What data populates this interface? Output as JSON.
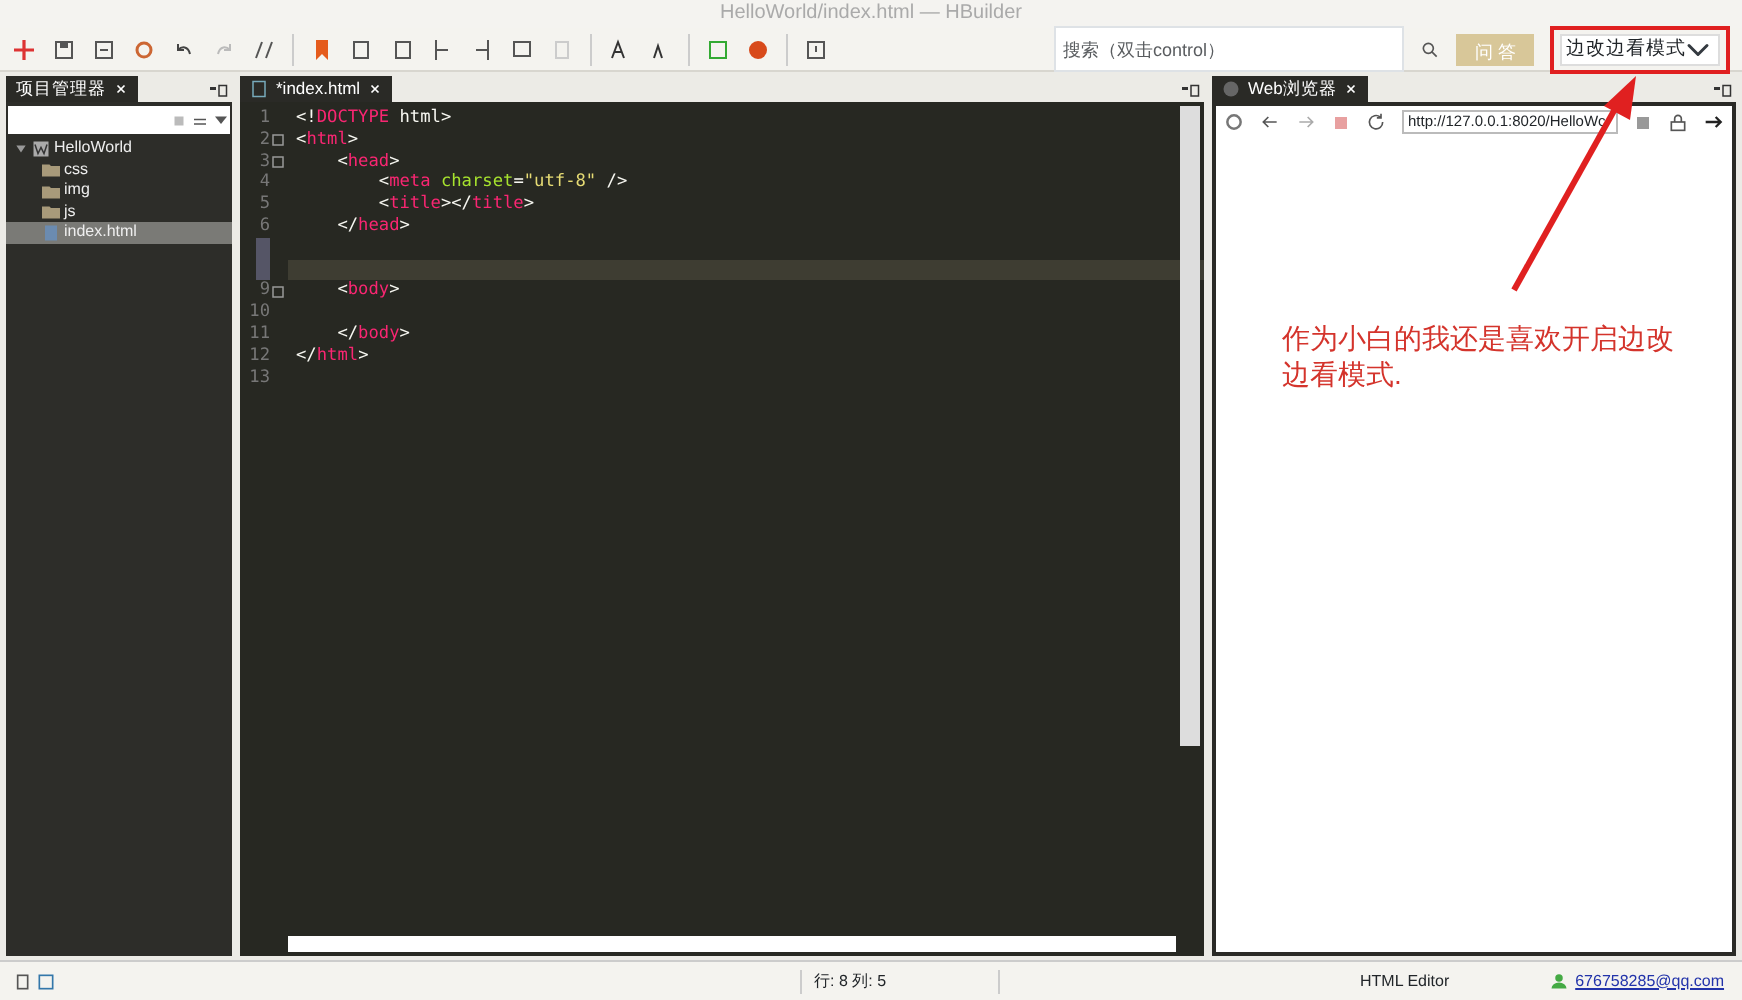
{
  "window": {
    "title": "HelloWorld/index.html — HBuilder"
  },
  "toolbar": {
    "search": {
      "placeholder": "搜索（双击control）"
    },
    "qa_button": "问 答",
    "mode_select": {
      "value": "边改边看模式"
    }
  },
  "project_panel": {
    "tab": "项目管理器",
    "tree": [
      {
        "label": "HelloWorld",
        "kind": "project",
        "expanded": true,
        "selected": false,
        "children": [
          {
            "label": "css",
            "kind": "folder",
            "selected": false
          },
          {
            "label": "img",
            "kind": "folder",
            "selected": false
          },
          {
            "label": "js",
            "kind": "folder",
            "selected": false
          },
          {
            "label": "index.html",
            "kind": "file",
            "selected": true
          }
        ]
      }
    ]
  },
  "editor": {
    "tab": "*index.html",
    "lines": [
      {
        "number": "1",
        "fold": false,
        "current": false,
        "tokens": [
          {
            "kind": "punct",
            "text": "<!"
          },
          {
            "kind": "tag",
            "text": "DOCTYPE"
          },
          {
            "kind": "punct",
            "text": " html>"
          }
        ]
      },
      {
        "number": "2",
        "fold": true,
        "current": false,
        "tokens": [
          {
            "kind": "punct",
            "text": "<"
          },
          {
            "kind": "tag",
            "text": "html"
          },
          {
            "kind": "punct",
            "text": ">"
          }
        ]
      },
      {
        "number": "3",
        "fold": true,
        "current": false,
        "tokens": [
          {
            "kind": "punct",
            "text": "    <"
          },
          {
            "kind": "tag",
            "text": "head"
          },
          {
            "kind": "punct",
            "text": ">"
          }
        ]
      },
      {
        "number": "4",
        "fold": false,
        "current": false,
        "tokens": [
          {
            "kind": "punct",
            "text": "        <"
          },
          {
            "kind": "tag",
            "text": "meta"
          },
          {
            "kind": "attr",
            "text": " charset"
          },
          {
            "kind": "punct",
            "text": "="
          },
          {
            "kind": "string",
            "text": "\"utf-8\""
          },
          {
            "kind": "punct",
            "text": " />"
          }
        ]
      },
      {
        "number": "5",
        "fold": false,
        "current": false,
        "tokens": [
          {
            "kind": "punct",
            "text": "        <"
          },
          {
            "kind": "tag",
            "text": "title"
          },
          {
            "kind": "punct",
            "text": "></"
          },
          {
            "kind": "tag",
            "text": "title"
          },
          {
            "kind": "punct",
            "text": ">"
          }
        ]
      },
      {
        "number": "6",
        "fold": false,
        "current": false,
        "tokens": [
          {
            "kind": "punct",
            "text": "    </"
          },
          {
            "kind": "tag",
            "text": "head"
          },
          {
            "kind": "punct",
            "text": ">"
          }
        ]
      },
      {
        "fold": false,
        "current": false
      },
      {
        "fold": false,
        "current": true
      },
      {
        "number": "9",
        "fold": true,
        "current": false,
        "tokens": [
          {
            "kind": "punct",
            "text": "    <"
          },
          {
            "kind": "tag",
            "text": "body"
          },
          {
            "kind": "punct",
            "text": ">"
          }
        ]
      },
      {
        "number": "10",
        "fold": false,
        "current": false
      },
      {
        "number": "11",
        "fold": false,
        "current": false,
        "tokens": [
          {
            "kind": "punct",
            "text": "    </"
          },
          {
            "kind": "tag",
            "text": "body"
          },
          {
            "kind": "punct",
            "text": ">"
          }
        ]
      },
      {
        "number": "12",
        "fold": false,
        "current": false,
        "tokens": [
          {
            "kind": "punct",
            "text": "</"
          },
          {
            "kind": "tag",
            "text": "html"
          },
          {
            "kind": "punct",
            "text": ">"
          }
        ]
      },
      {
        "number": "13",
        "fold": false,
        "current": false
      }
    ]
  },
  "browser_panel": {
    "tab": "Web浏览器",
    "url": "http://127.0.0.1:8020/HelloWc"
  },
  "annotation": {
    "text": "作为小白的我还是喜欢开启边改边看模式."
  },
  "status_bar": {
    "position": "行: 8 列: 5",
    "editor_type": "HTML Editor",
    "account": "676758285@qq.com"
  }
}
